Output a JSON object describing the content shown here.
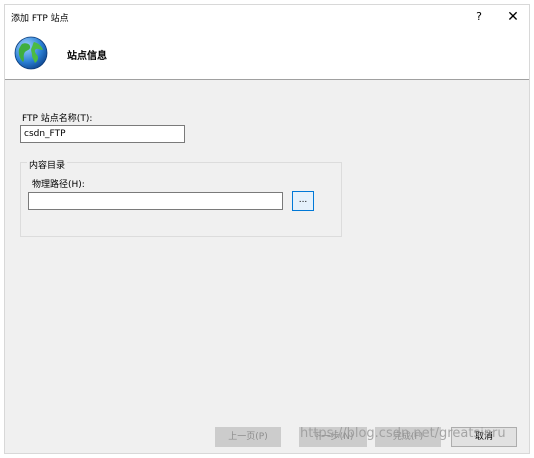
{
  "window": {
    "title": "添加 FTP 站点",
    "help_label": "?",
    "close_label": "✕"
  },
  "header": {
    "title": "站点信息",
    "icon": "globe-icon"
  },
  "site_name": {
    "label": "FTP 站点名称(T):",
    "value": "csdn_FTP"
  },
  "content_dir": {
    "legend": "内容目录",
    "physical_path": {
      "label": "物理路径(H):",
      "value": "",
      "browse_label": "..."
    }
  },
  "footer": {
    "prev_label": "上一页(P)",
    "next_label": "下一步(N)",
    "finish_label": "完成(F)",
    "cancel_label": "取消"
  },
  "watermark": "https://blog.csdn.net/greatsinru"
}
